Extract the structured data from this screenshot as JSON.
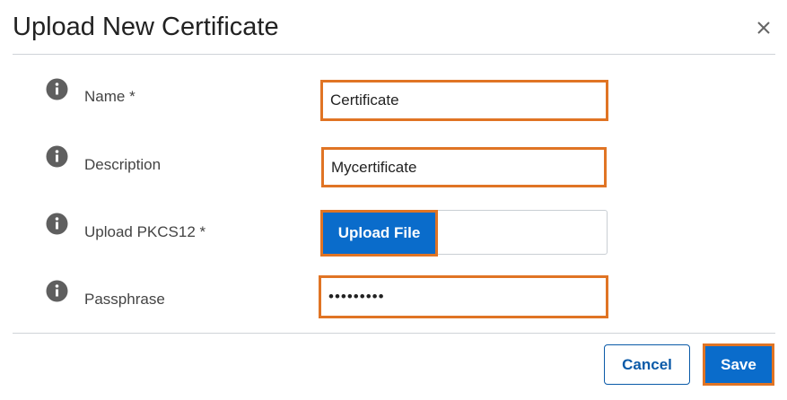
{
  "dialog": {
    "title": "Upload New Certificate",
    "close_icon": "close-icon"
  },
  "form": {
    "fields": [
      {
        "label": "Name *",
        "value": "Certificate",
        "icon": "info-icon"
      },
      {
        "label": "Description",
        "value": "Mycertificate",
        "icon": "info-icon"
      },
      {
        "label": "Upload PKCS12 *",
        "button_label": "Upload File",
        "icon": "info-icon"
      },
      {
        "label": "Passphrase",
        "value": "•••••••••",
        "icon": "info-icon"
      }
    ]
  },
  "footer": {
    "cancel_label": "Cancel",
    "save_label": "Save"
  },
  "colors": {
    "primary": "#0a6ccb",
    "highlight_border": "#e07424",
    "info_icon": "#5f5f5f"
  }
}
